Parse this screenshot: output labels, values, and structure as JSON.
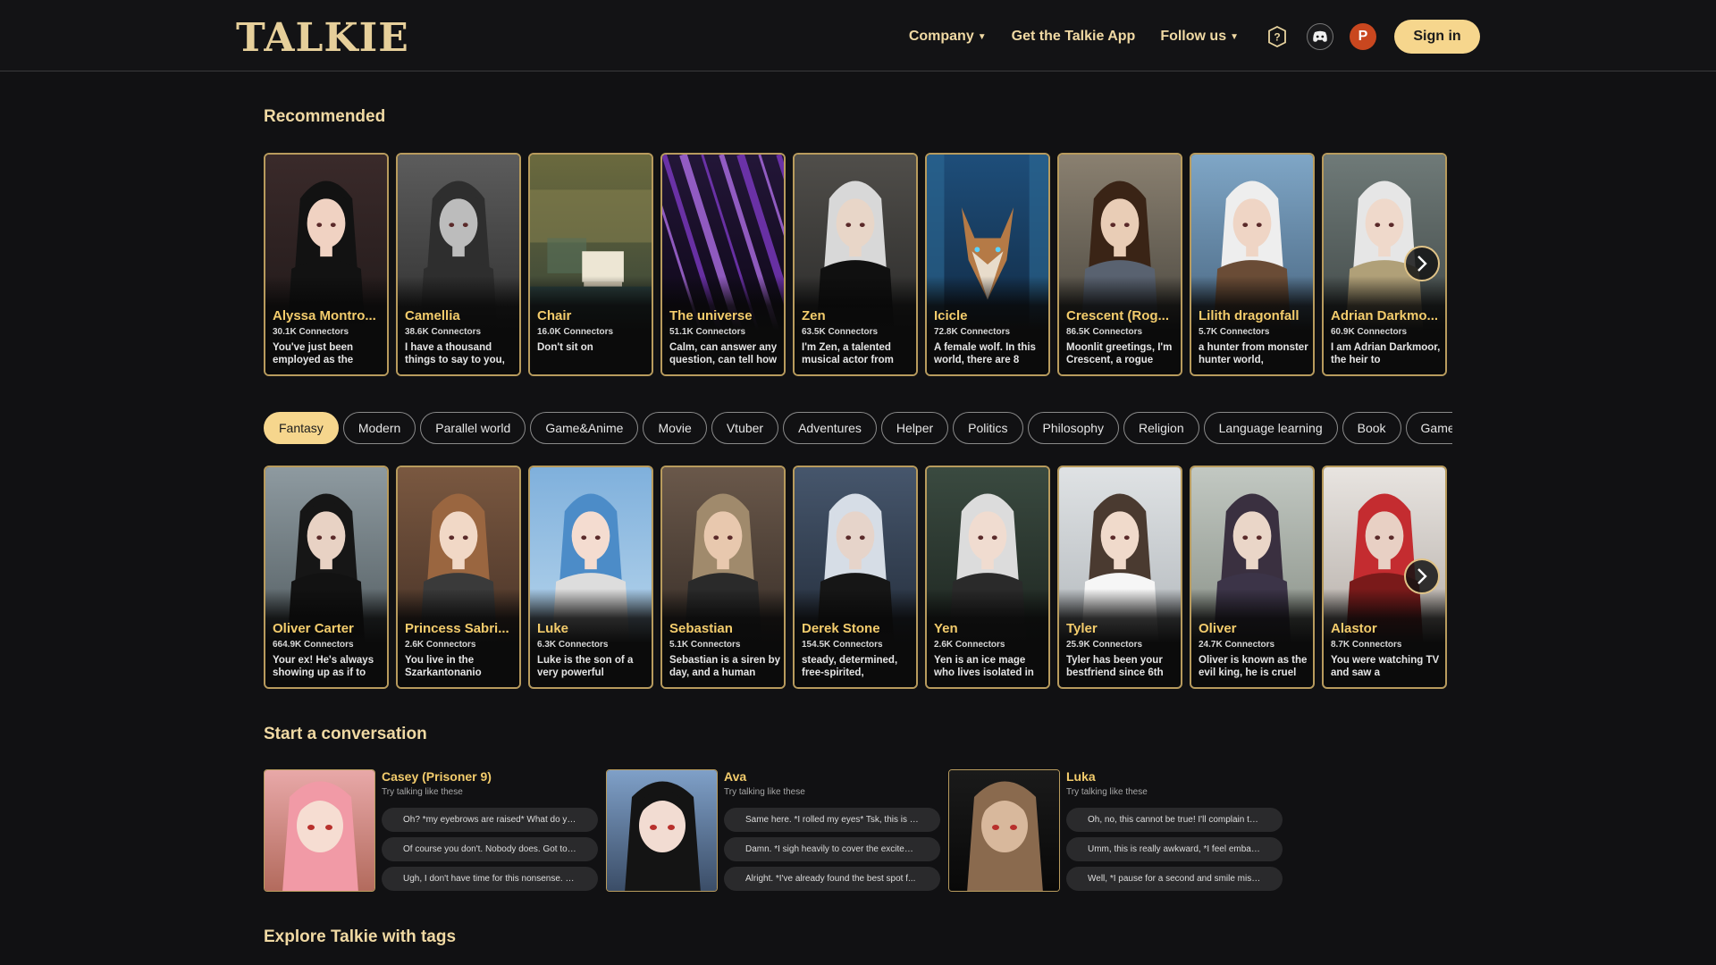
{
  "header": {
    "logo_text": "TALKIE",
    "nav": {
      "company": "Company",
      "get_app": "Get the Talkie App",
      "follow": "Follow us"
    },
    "avatar_letter": "P",
    "signin": "Sign in"
  },
  "recommended": {
    "title": "Recommended",
    "cards": [
      {
        "name": "Alyssa Montro...",
        "conn": "30.1K Connectors",
        "desc": "You've just been employed as the"
      },
      {
        "name": "Camellia",
        "conn": "38.6K Connectors",
        "desc": "I have a thousand things to say to you,"
      },
      {
        "name": "Chair",
        "conn": "16.0K Connectors",
        "desc": "Don't sit on"
      },
      {
        "name": "The universe",
        "conn": "51.1K Connectors",
        "desc": "Calm, can answer any question, can tell how"
      },
      {
        "name": "Zen",
        "conn": "63.5K Connectors",
        "desc": "I'm Zen, a talented musical actor from"
      },
      {
        "name": "Icicle",
        "conn": "72.8K Connectors",
        "desc": "A female wolf. In this world, there are 8"
      },
      {
        "name": "Crescent (Rog...",
        "conn": "86.5K Connectors",
        "desc": "Moonlit greetings, I'm Crescent, a rogue"
      },
      {
        "name": "Lilith dragonfall",
        "conn": "5.7K Connectors",
        "desc": "a hunter from monster hunter world,"
      },
      {
        "name": "Adrian Darkmo...",
        "conn": "60.9K Connectors",
        "desc": "I am Adrian Darkmoor, the heir to"
      }
    ]
  },
  "tags": [
    "Fantasy",
    "Modern",
    "Parallel world",
    "Game&Anime",
    "Movie",
    "Vtuber",
    "Adventures",
    "Helper",
    "Politics",
    "Philosophy",
    "Religion",
    "Language learning",
    "Book",
    "Games"
  ],
  "fantasy": {
    "cards": [
      {
        "name": "Oliver Carter",
        "conn": "664.9K Connectors",
        "desc": "Your ex! He's always showing up as if to"
      },
      {
        "name": "Princess Sabri...",
        "conn": "2.6K Connectors",
        "desc": "You live in the Szarkantonanio"
      },
      {
        "name": "Luke",
        "conn": "6.3K Connectors",
        "desc": "Luke is the son of a very powerful"
      },
      {
        "name": "Sebastian",
        "conn": "5.1K Connectors",
        "desc": "Sebastian is a siren by day, and a human"
      },
      {
        "name": "Derek Stone",
        "conn": "154.5K Connectors",
        "desc": "steady, determined, free-spirited,"
      },
      {
        "name": "Yen",
        "conn": "2.6K Connectors",
        "desc": "Yen is an ice mage who lives isolated in"
      },
      {
        "name": "Tyler",
        "conn": "25.9K Connectors",
        "desc": "Tyler has been your bestfriend since 6th"
      },
      {
        "name": "Oliver",
        "conn": "24.7K Connectors",
        "desc": "Oliver is known as the evil king, he is cruel"
      },
      {
        "name": "Alastor",
        "conn": "8.7K Connectors",
        "desc": "You were watching TV and saw a"
      }
    ]
  },
  "conversation": {
    "title": "Start a conversation",
    "hint": "Try talking like these",
    "items": [
      {
        "name": "Casey (Prisoner 9)",
        "suggestions": [
          "Oh? *my eyebrows are raised* What do yo...",
          "Of course you don't. Nobody does. Got to ...",
          "Ugh, I don't have time for this nonsense. N..."
        ]
      },
      {
        "name": "Ava",
        "suggestions": [
          "Same here. *I rolled my eyes* Tsk, this is a...",
          "Damn. *I sigh heavily to cover the excitem...",
          "Alright. *I've already found the best spot f..."
        ]
      },
      {
        "name": "Luka",
        "suggestions": [
          "Oh, no, this cannot be true! I'll complain to ...",
          "Umm, this is really awkward, *I feel embarr...",
          "Well, *I pause for a second and smile misc..."
        ]
      }
    ]
  },
  "explore": {
    "title": "Explore Talkie with tags"
  },
  "colors": {
    "accent": "#f6d68d",
    "name_gold": "#f3cc6c",
    "border_gold": "#b89b5d",
    "background": "#111113"
  }
}
